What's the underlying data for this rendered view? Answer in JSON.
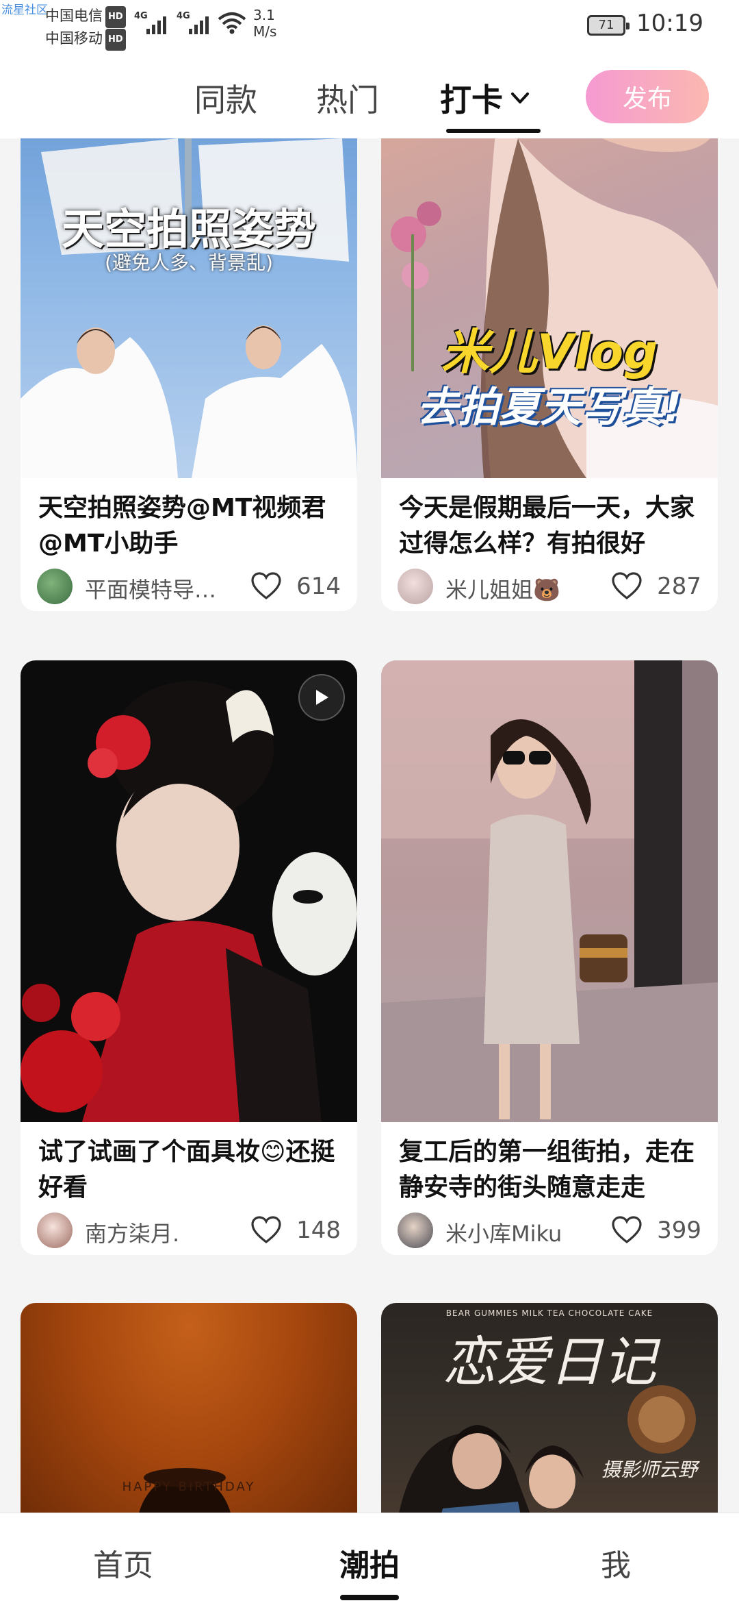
{
  "status_bar": {
    "watermark": "流星社区",
    "carrier1": "中国电信",
    "carrier2": "中国移动",
    "hd_badge": "HD",
    "network1": "4G",
    "network2": "4G",
    "speed_value": "3.1",
    "speed_unit": "M/s",
    "battery": "71",
    "time": "10:19"
  },
  "top_tabs": {
    "items": [
      {
        "label": "同款",
        "active": false
      },
      {
        "label": "热门",
        "active": false
      },
      {
        "label": "打卡",
        "active": true
      }
    ],
    "publish_label": "发布",
    "publish_gradient": [
      "#f59ad2",
      "#fbb8b0"
    ]
  },
  "cards": [
    {
      "overlay_title": "天空拍照姿势",
      "overlay_subtitle": "(避免人多、背景乱)",
      "title": "天空拍照姿势@MT视频君 @MT小助手",
      "author": "平面模特导…",
      "likes": "614",
      "has_play": false
    },
    {
      "overlay_line1": "米儿Vlog",
      "overlay_line2": "去拍夏天写真!",
      "title": "今天是假期最后一天，大家过得怎么样？有拍很好",
      "author": "米儿姐姐🐻",
      "likes": "287",
      "has_play": false
    },
    {
      "title": "试了试画了个面具妆😊还挺好看",
      "author": "南方柒月.",
      "likes": "148",
      "has_play": true
    },
    {
      "title": "复工后的第一组街拍，走在静安寺的街头随意走走",
      "author": "米小库Miku",
      "likes": "399",
      "has_play": false
    },
    {
      "overlay_text": "HAPPY BIRTHDAY"
    },
    {
      "overlay_top": "BEAR GUMMIES   MILK TEA   CHOCOLATE CAKE",
      "overlay_title": "恋爱日记",
      "overlay_sub": "摄影师云野"
    }
  ],
  "bottom_nav": {
    "items": [
      {
        "label": "首页",
        "active": false
      },
      {
        "label": "潮拍",
        "active": true
      },
      {
        "label": "我",
        "active": false
      }
    ]
  }
}
